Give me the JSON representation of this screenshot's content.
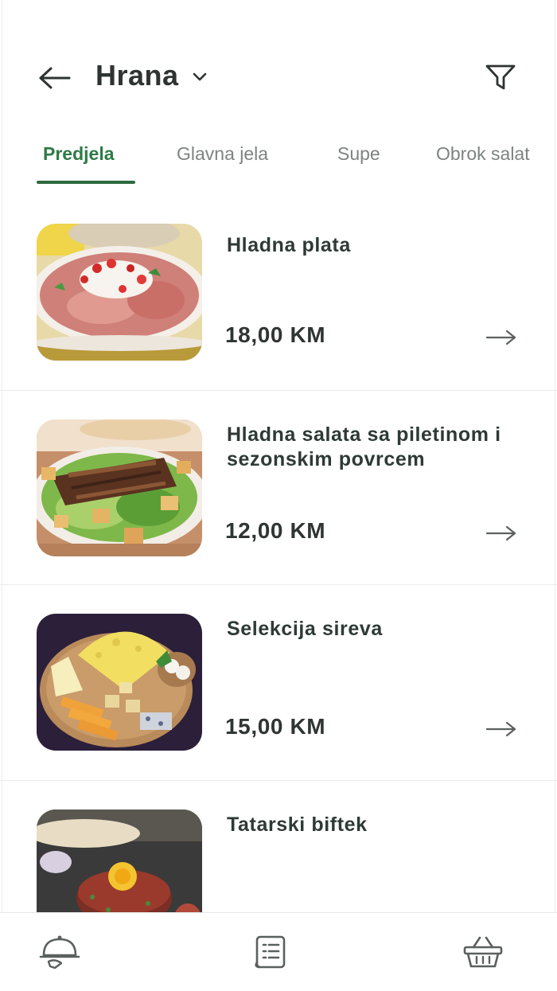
{
  "header": {
    "title": "Hrana",
    "back_icon": "arrow-left-icon",
    "dropdown_icon": "chevron-down-icon",
    "filter_icon": "filter-icon"
  },
  "tabs": [
    {
      "label": "Predjela",
      "active": true
    },
    {
      "label": "Glavna jela",
      "active": false
    },
    {
      "label": "Supe",
      "active": false
    },
    {
      "label": "Obrok salat",
      "active": false
    }
  ],
  "items": [
    {
      "name": "Hladna plata",
      "price": "18,00 KM",
      "image": "cold-platter-photo"
    },
    {
      "name": "Hladna salata sa piletinom i sezonskim povrcem",
      "price": "12,00 KM",
      "image": "chicken-salad-photo"
    },
    {
      "name": "Selekcija sireva",
      "price": "15,00 KM",
      "image": "cheese-board-photo"
    },
    {
      "name": "Tatarski biftek",
      "price": "",
      "image": "steak-tartare-photo"
    }
  ],
  "bottom_nav": [
    {
      "icon": "waiter-cloche-icon"
    },
    {
      "icon": "menu-receipt-icon"
    },
    {
      "icon": "basket-icon"
    }
  ],
  "colors": {
    "accent": "#2d7a45",
    "text_dark": "#2e3431",
    "text_muted": "#7d8380",
    "divider": "#ececec"
  }
}
